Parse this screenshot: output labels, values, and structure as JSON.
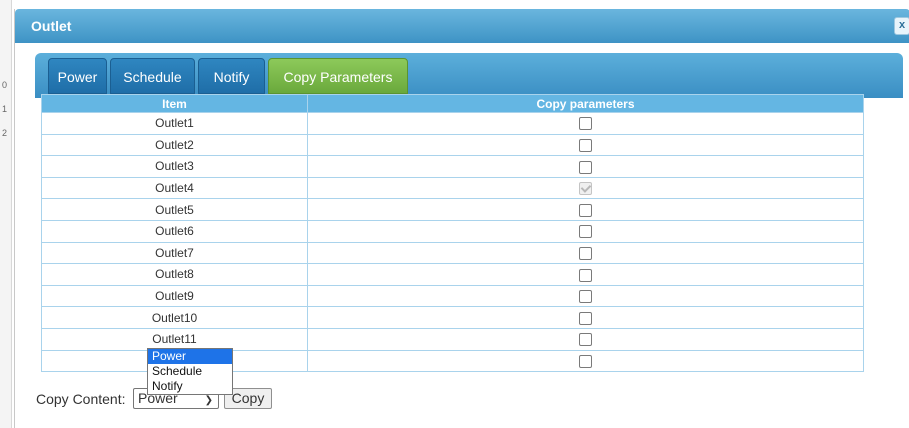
{
  "dialog": {
    "title": "Outlet",
    "close_label": "x"
  },
  "tabs": [
    {
      "label": "Power",
      "active": false
    },
    {
      "label": "Schedule",
      "active": false
    },
    {
      "label": "Notify",
      "active": false
    },
    {
      "label": "Copy Parameters",
      "active": true
    }
  ],
  "table": {
    "headers": [
      "Item",
      "Copy parameters"
    ],
    "rows": [
      {
        "item": "Outlet1",
        "checked": false,
        "disabled": false
      },
      {
        "item": "Outlet2",
        "checked": false,
        "disabled": false
      },
      {
        "item": "Outlet3",
        "checked": false,
        "disabled": false
      },
      {
        "item": "Outlet4",
        "checked": true,
        "disabled": true
      },
      {
        "item": "Outlet5",
        "checked": false,
        "disabled": false
      },
      {
        "item": "Outlet6",
        "checked": false,
        "disabled": false
      },
      {
        "item": "Outlet7",
        "checked": false,
        "disabled": false
      },
      {
        "item": "Outlet8",
        "checked": false,
        "disabled": false
      },
      {
        "item": "Outlet9",
        "checked": false,
        "disabled": false
      },
      {
        "item": "Outlet10",
        "checked": false,
        "disabled": false
      },
      {
        "item": "Outlet11",
        "checked": false,
        "disabled": false
      },
      {
        "item": "",
        "checked": false,
        "disabled": false
      }
    ]
  },
  "copy": {
    "label": "Copy Content:",
    "selected": "Power",
    "button_label": "Copy",
    "options": [
      "Power",
      "Schedule",
      "Notify"
    ]
  },
  "background_digits": [
    "0",
    "1",
    "2"
  ],
  "colors": {
    "header_blue": "#3e93c5",
    "tab_active_green": "#6aa93c",
    "table_header": "#64b6e3"
  }
}
